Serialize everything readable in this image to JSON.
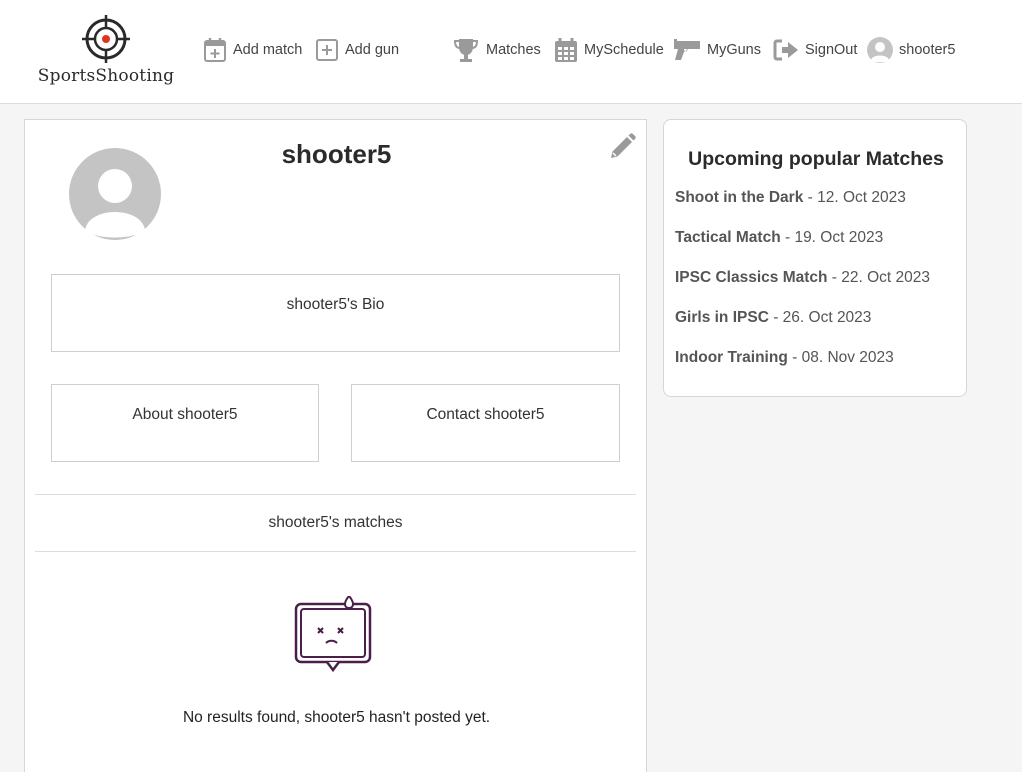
{
  "brand": {
    "name": "SportsShooting"
  },
  "nav": {
    "add_match": "Add match",
    "add_gun": "Add gun",
    "matches": "Matches",
    "schedule": "MySchedule",
    "guns": "MyGuns",
    "signout": "SignOut",
    "user": "shooter5"
  },
  "profile": {
    "username": "shooter5",
    "bio_label": "shooter5's Bio",
    "about_label": "About shooter5",
    "contact_label": "Contact shooter5",
    "matches_label": "shooter5's matches",
    "empty_text": "No results found, shooter5 hasn't posted yet."
  },
  "upcoming": {
    "title": "Upcoming popular Matches",
    "items": [
      {
        "name": "Shoot in the Dark",
        "date": " - 12. Oct 2023"
      },
      {
        "name": "Tactical Match",
        "date": " - 19. Oct 2023"
      },
      {
        "name": "IPSC Classics Match",
        "date": " - 22. Oct 2023"
      },
      {
        "name": "Girls in IPSC",
        "date": " - 26. Oct 2023"
      },
      {
        "name": "Indoor Training",
        "date": " - 08. Nov 2023"
      }
    ]
  },
  "colors": {
    "accent": "#e0341e",
    "empty_icon": "#4a1f4a",
    "icon_gray": "#9a9a9a"
  }
}
